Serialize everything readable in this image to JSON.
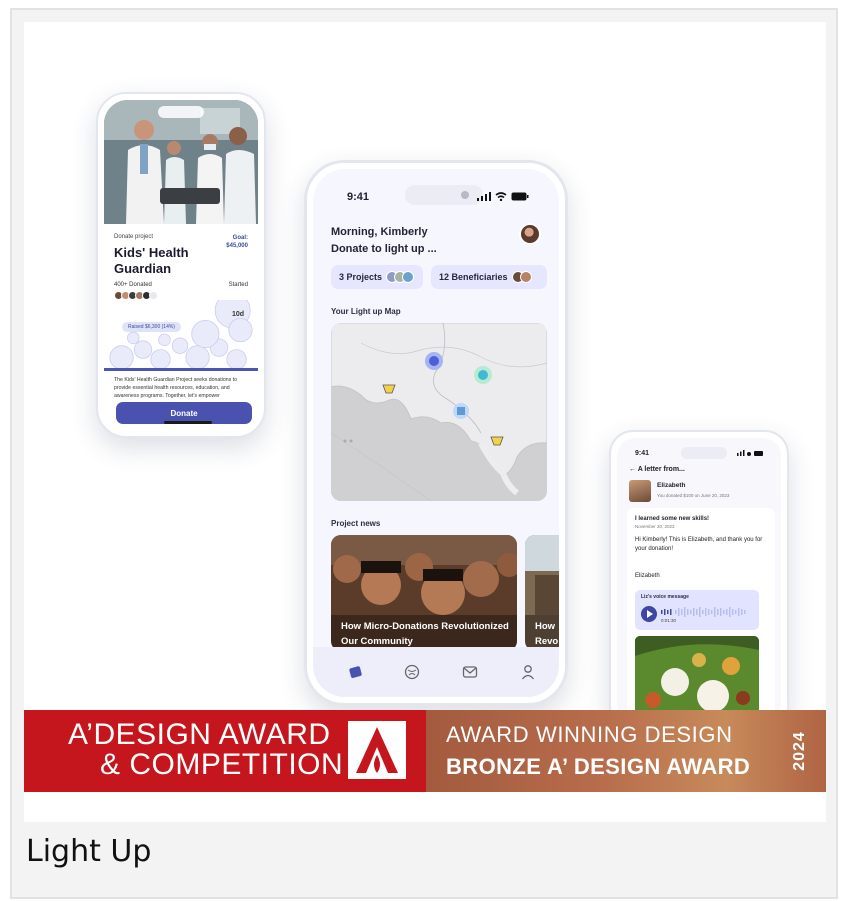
{
  "caption": "Light Up",
  "colors": {
    "accent": "#4a52b0",
    "banner_red": "#c4161c",
    "banner_bronze": "#b86e4c",
    "screen_bg": "#f6f6ff"
  },
  "phone1": {
    "sublabel": "Donate project",
    "goal_label": "Goal:",
    "goal_value": "$45,000",
    "title": "Kids' Health Guardian",
    "donated": "400+ Donated",
    "started": "Started",
    "started_value": "10d",
    "raised": "Raised $6,300 (14%)",
    "raised_fraction": 0.14,
    "description": "The Kids' Health Guardian Project seeks donations to provide essential health resources, education, and awareness programs. Together, let's empower",
    "donate_button": "Donate"
  },
  "phone2": {
    "time": "9:41",
    "greeting_line1": "Morning, Kimberly",
    "greeting_line2": "Donate to light up ...",
    "chips": [
      {
        "label": "3 Projects"
      },
      {
        "label": "12 Beneficiaries"
      }
    ],
    "map_label": "Your Light up Map",
    "news_label": "Project news",
    "news_cards": [
      {
        "title": "How Micro-Donations Revolutionized Our Community"
      },
      {
        "title": "How Revo"
      }
    ],
    "tabs": [
      "home-icon",
      "globe-icon",
      "mail-icon",
      "profile-icon"
    ]
  },
  "phone3": {
    "time": "9:41",
    "back_title": "A letter from...",
    "sender_name": "Elizabeth",
    "sender_note": "You donated $100 on June 20, 2023",
    "letter_title": "I learned some new skills!",
    "letter_date": "November 20, 2023",
    "letter_body": "Hi Kimberly! This is Elizabeth, and thank you for your donation!",
    "letter_sign": "Elizabeth",
    "voice_label": "Liz's voice message",
    "voice_time": "0:01:30"
  },
  "banner": {
    "left_line1": "A’DESIGN AWARD",
    "left_line2": "& COMPETITION",
    "right_line1": "AWARD WINNING DESIGN",
    "right_line2": "BRONZE A’ DESIGN AWARD",
    "year": "2024"
  }
}
